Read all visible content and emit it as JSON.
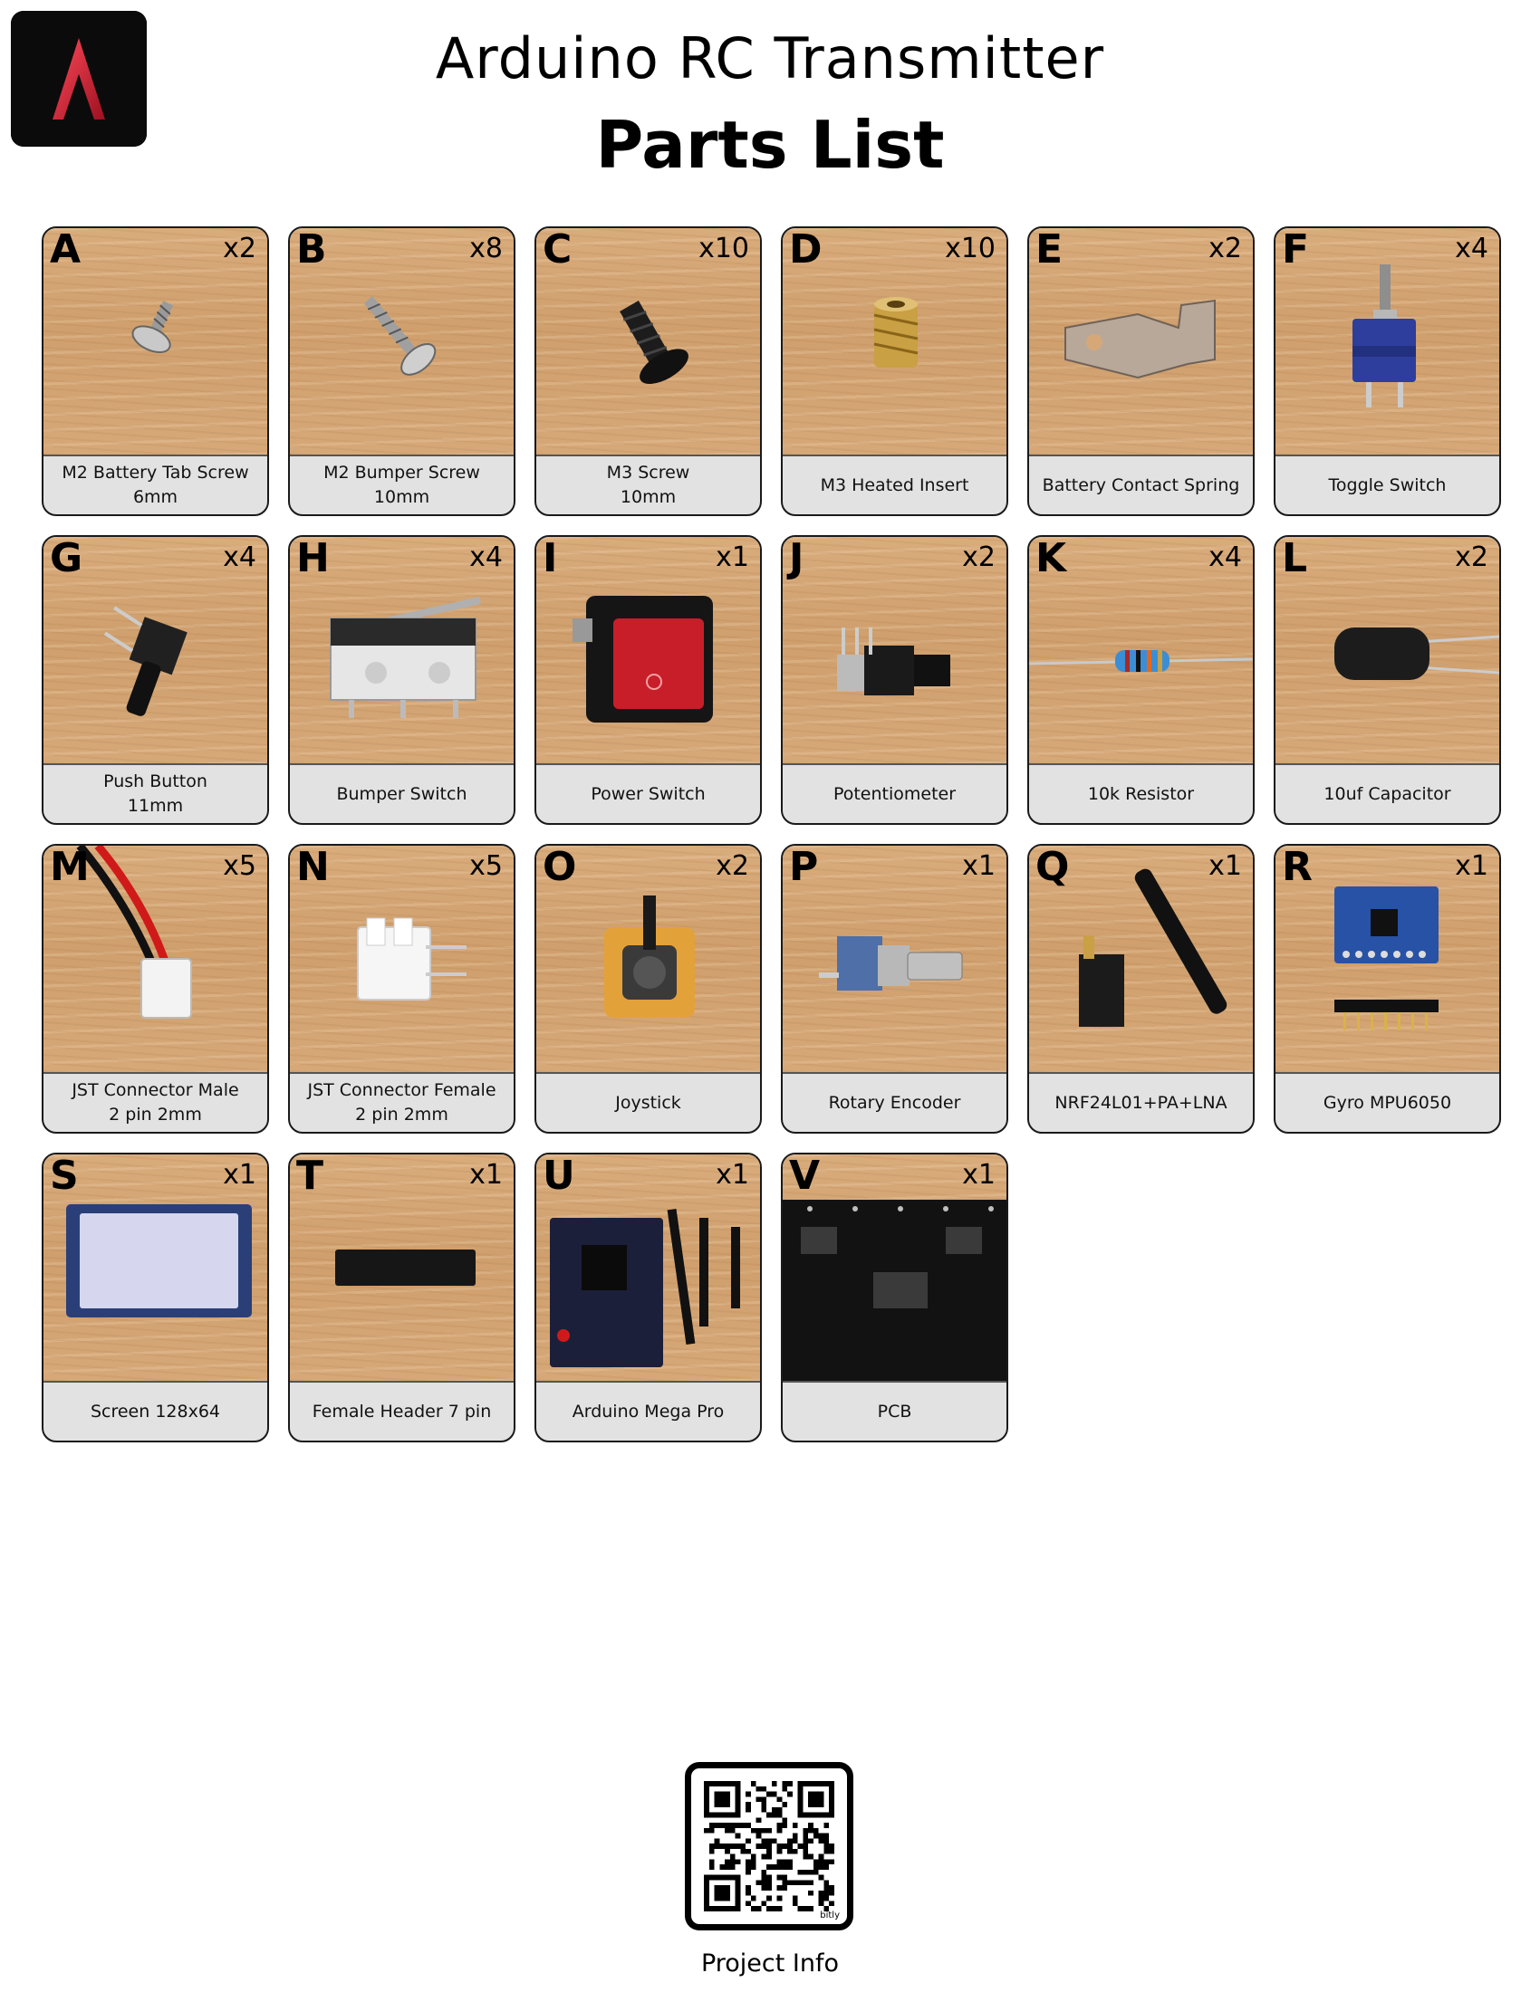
{
  "header": {
    "title": "Arduino RC Transmitter",
    "subtitle": "Parts List",
    "logo_icon": "red-letter-a-logo"
  },
  "parts": [
    {
      "letter": "A",
      "qty": "x2",
      "line1": "M2 Battery Tab Screw",
      "line2": "6mm",
      "icon": "small-screw-icon"
    },
    {
      "letter": "B",
      "qty": "x8",
      "line1": "M2 Bumper Screw",
      "line2": "10mm",
      "icon": "long-screw-icon"
    },
    {
      "letter": "C",
      "qty": "x10",
      "line1": "M3 Screw",
      "line2": "10mm",
      "icon": "black-screw-icon"
    },
    {
      "letter": "D",
      "qty": "x10",
      "line1": "M3 Heated Insert",
      "line2": "",
      "icon": "brass-insert-icon"
    },
    {
      "letter": "E",
      "qty": "x2",
      "line1": "Battery Contact Spring",
      "line2": "",
      "icon": "spring-contact-icon"
    },
    {
      "letter": "F",
      "qty": "x4",
      "line1": "Toggle Switch",
      "line2": "",
      "icon": "toggle-switch-icon"
    },
    {
      "letter": "G",
      "qty": "x4",
      "line1": "Push Button",
      "line2": "11mm",
      "icon": "push-button-icon"
    },
    {
      "letter": "H",
      "qty": "x4",
      "line1": "Bumper Switch",
      "line2": "",
      "icon": "micro-switch-icon"
    },
    {
      "letter": "I",
      "qty": "x1",
      "line1": "Power Switch",
      "line2": "",
      "icon": "rocker-switch-icon"
    },
    {
      "letter": "J",
      "qty": "x2",
      "line1": "Potentiometer",
      "line2": "",
      "icon": "potentiometer-icon"
    },
    {
      "letter": "K",
      "qty": "x4",
      "line1": "10k Resistor",
      "line2": "",
      "icon": "resistor-icon"
    },
    {
      "letter": "L",
      "qty": "x2",
      "line1": "10uf Capacitor",
      "line2": "",
      "icon": "capacitor-icon"
    },
    {
      "letter": "M",
      "qty": "x5",
      "line1": "JST Connector Male",
      "line2": "2 pin 2mm",
      "icon": "jst-male-icon"
    },
    {
      "letter": "N",
      "qty": "x5",
      "line1": "JST Connector Female",
      "line2": "2 pin 2mm",
      "icon": "jst-female-icon"
    },
    {
      "letter": "O",
      "qty": "x2",
      "line1": "Joystick",
      "line2": "",
      "icon": "joystick-icon"
    },
    {
      "letter": "P",
      "qty": "x1",
      "line1": "Rotary Encoder",
      "line2": "",
      "icon": "rotary-encoder-icon"
    },
    {
      "letter": "Q",
      "qty": "x1",
      "line1": "NRF24L01+PA+LNA",
      "line2": "",
      "icon": "antenna-module-icon"
    },
    {
      "letter": "R",
      "qty": "x1",
      "line1": "Gyro MPU6050",
      "line2": "",
      "icon": "gyro-board-icon"
    },
    {
      "letter": "S",
      "qty": "x1",
      "line1": "Screen 128x64",
      "line2": "",
      "icon": "oled-screen-icon"
    },
    {
      "letter": "T",
      "qty": "x1",
      "line1": "Female Header 7 pin",
      "line2": "",
      "icon": "female-header-icon"
    },
    {
      "letter": "U",
      "qty": "x1",
      "line1": "Arduino Mega Pro",
      "line2": "",
      "icon": "arduino-board-icon"
    },
    {
      "letter": "V",
      "qty": "x1",
      "line1": "PCB",
      "line2": "",
      "icon": "pcb-icon"
    }
  ],
  "qr": {
    "caption": "Project Info",
    "brand": "bitly",
    "icon": "qr-code-icon"
  }
}
